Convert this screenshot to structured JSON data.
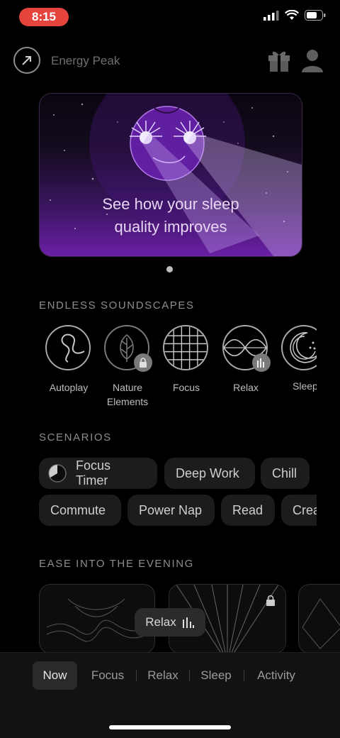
{
  "status_bar": {
    "time": "8:15"
  },
  "header": {
    "energy_label": "Energy Peak"
  },
  "hero": {
    "line1": "See how your sleep",
    "line2": "quality improves"
  },
  "soundscapes": {
    "title": "ENDLESS SOUNDSCAPES",
    "items": [
      {
        "label": "Autoplay"
      },
      {
        "label": "Nature",
        "label2": "Elements"
      },
      {
        "label": "Focus"
      },
      {
        "label": "Relax"
      },
      {
        "label": "Sleep"
      }
    ]
  },
  "scenarios": {
    "title": "SCENARIOS",
    "row1": [
      "Focus Timer",
      "Deep Work",
      "Chill"
    ],
    "row2": [
      "Commute",
      "Power Nap",
      "Read",
      "Create"
    ]
  },
  "evening": {
    "title": "EASE INTO THE EVENING"
  },
  "now_playing": {
    "label": "Relax"
  },
  "nav": {
    "items": [
      "Now",
      "Focus",
      "Relax",
      "Sleep",
      "Activity"
    ]
  }
}
